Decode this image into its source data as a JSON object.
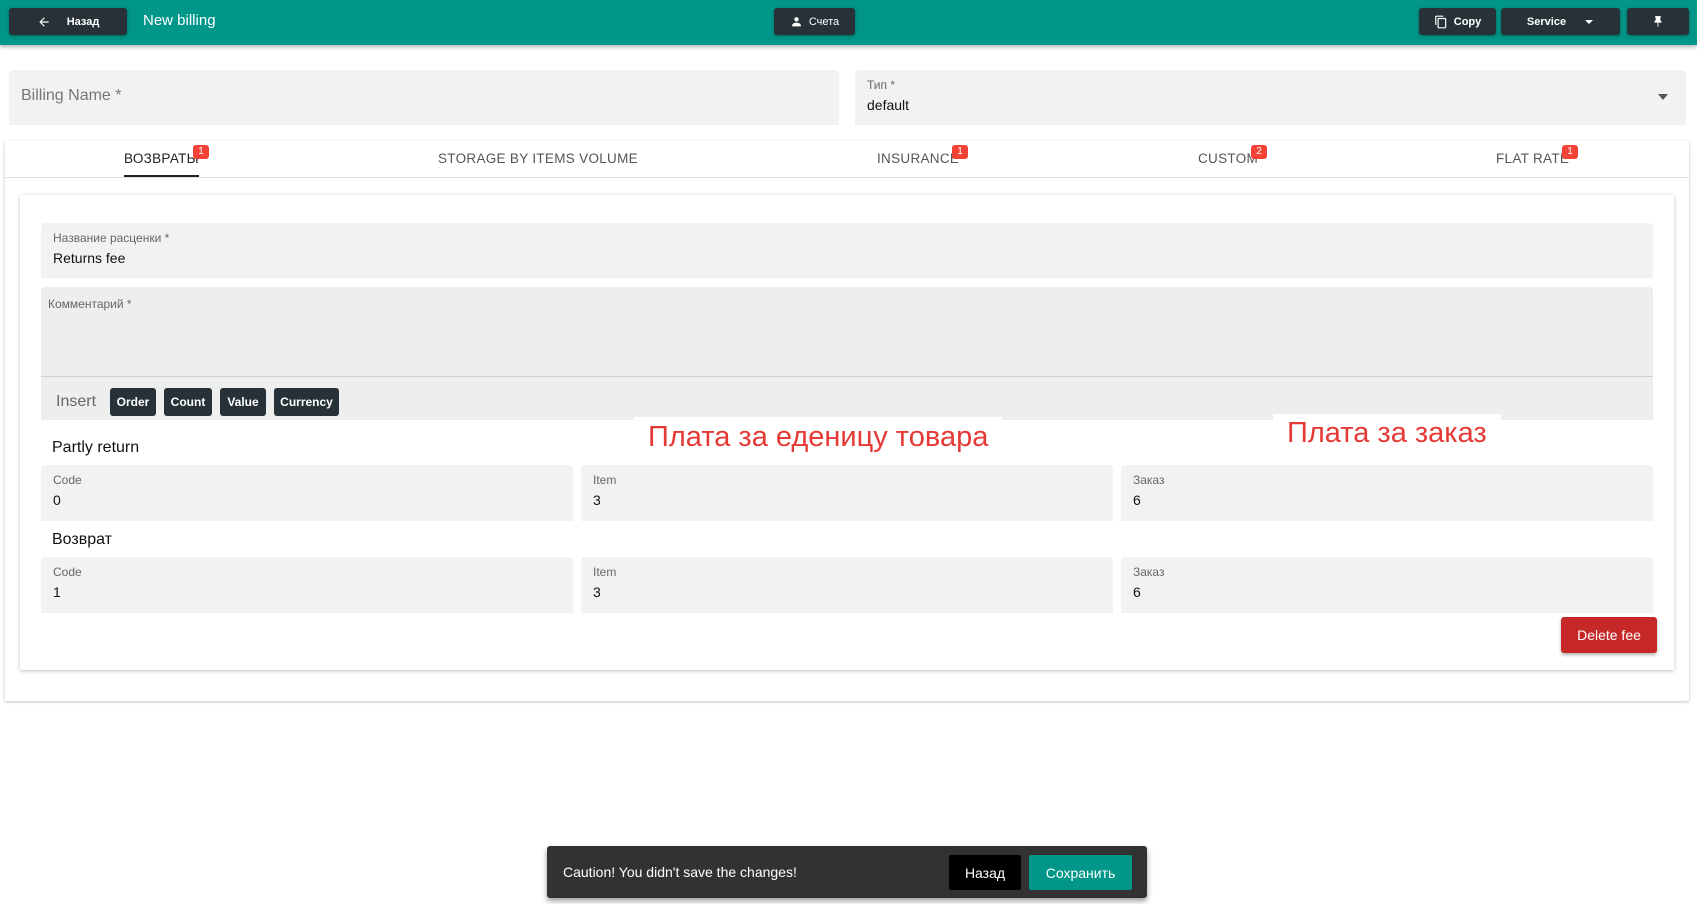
{
  "header": {
    "back_label": "Назад",
    "title": "New billing",
    "accounts_label": "Счета",
    "copy_label": "Copy",
    "service_label": "Service",
    "bg_color": "#009688",
    "button_color": "#263238"
  },
  "form": {
    "billing_name": {
      "label": "Billing Name *",
      "value": ""
    },
    "type": {
      "label": "Тип *",
      "value": "default"
    }
  },
  "tabs": [
    {
      "label": "ВОЗВРАТЫ",
      "badge": "1",
      "active": true
    },
    {
      "label": "STORAGE BY ITEMS VOLUME",
      "badge": "",
      "active": false
    },
    {
      "label": "INSURANCE",
      "badge": "1",
      "active": false
    },
    {
      "label": "CUSTOM",
      "badge": "2",
      "active": false
    },
    {
      "label": "FLAT RATE",
      "badge": "1",
      "active": false
    }
  ],
  "fee": {
    "name": {
      "label": "Название расценки *",
      "value": "Returns fee"
    },
    "comment": {
      "label": "Комментарий *",
      "value": ""
    },
    "insert_label": "Insert",
    "insert_chips": [
      "Order",
      "Count",
      "Value",
      "Currency"
    ],
    "annotations": {
      "per_item": "Плата за еденицу товара",
      "per_order": "Плата за заказ"
    },
    "sections": [
      {
        "title": "Partly return",
        "fields": [
          {
            "label": "Code",
            "value": "0"
          },
          {
            "label": "Item",
            "value": "3"
          },
          {
            "label": "Заказ",
            "value": "6"
          }
        ]
      },
      {
        "title": "Возврат",
        "fields": [
          {
            "label": "Code",
            "value": "1"
          },
          {
            "label": "Item",
            "value": "3"
          },
          {
            "label": "Заказ",
            "value": "6"
          }
        ]
      }
    ],
    "delete_label": "Delete fee"
  },
  "snackbar": {
    "message": "Caution! You didn't save the changes!",
    "back_label": "Назад",
    "save_label": "Сохранить"
  },
  "icons": {
    "back": "arrow-left-icon",
    "accounts": "person-icon",
    "copy": "copy-icon",
    "service": "chevron-down-icon",
    "pin": "pin-icon",
    "type": "dropdown-arrow-icon"
  }
}
